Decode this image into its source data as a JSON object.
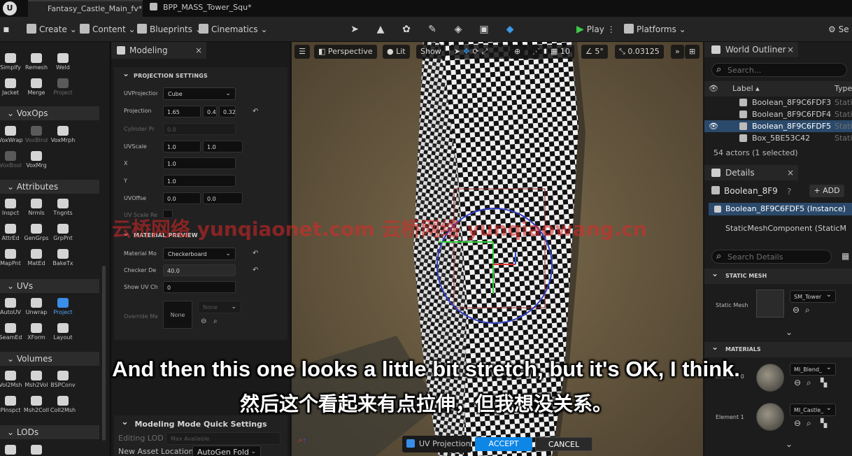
{
  "tabs": [
    {
      "label": "Fantasy_Castle_Main_fv*"
    },
    {
      "label": "BPP_MASS_Tower_Squ*"
    }
  ],
  "toolbar": {
    "create": "Create",
    "content": "Content",
    "blueprints": "Blueprints",
    "cinematics": "Cinematics",
    "play": "Play",
    "platforms": "Platforms",
    "settings": "Se"
  },
  "palette": {
    "top_tools": [
      "Simplfy",
      "Remesh",
      "Weld",
      "Jacket",
      "Merge",
      "Project"
    ],
    "voxops": {
      "title": "VoxOps",
      "tools": [
        "VoxWrap",
        "VoxBlnd",
        "VoxMrph",
        "VoxBool",
        "VoxMrg"
      ]
    },
    "attributes": {
      "title": "Attributes",
      "tools": [
        "Inspct",
        "Nrmls",
        "Tngnts",
        "AttrEd",
        "GenGrps",
        "GrpPnt",
        "MapPnt",
        "MatEd",
        "BakeTx"
      ]
    },
    "uvs": {
      "title": "UVs",
      "tools": [
        "AutoUV",
        "Unwrap",
        "Project",
        "SeamEd",
        "XForm",
        "Layout"
      ]
    },
    "volumes": {
      "title": "Volumes",
      "tools": [
        "Vol2Msh",
        "Msh2Vol",
        "BSPConv",
        "PInspct",
        "Msh2Coll",
        "Coll2Msh"
      ]
    },
    "lods": {
      "title": "LODs"
    }
  },
  "modeling": {
    "tab_title": "Modeling",
    "projection_settings": "PROJECTION SETTINGS",
    "uv_projection_label": "UVProjection",
    "uv_projection_value": "Cube",
    "projection_label": "Projection",
    "projection_values": [
      "1.65",
      "0.41",
      "0.32"
    ],
    "cylinder_label": "Cylinder Pr",
    "cylinder_value": "0.0",
    "uvscale_label": "UVScale",
    "uvscale_values": [
      "1.0",
      "1.0"
    ],
    "x_label": "X",
    "x_value": "1.0",
    "y_label": "Y",
    "y_value": "1.0",
    "uvoffset_label": "UVOffse",
    "uvoffset_values": [
      "0.0",
      "0.0"
    ],
    "uvscale_rel_label": "UV Scale Re",
    "material_preview": "MATERIAL PREVIEW",
    "material_mode_label": "Material Mo",
    "material_mode_value": "Checkerboard",
    "checker_density_label": "Checker De",
    "checker_density_value": "40.0",
    "show_uv_label": "Show UV Ch",
    "show_uv_value": "0",
    "override_label": "Override Ma",
    "override_thumb": "None",
    "override_combo": "None",
    "quick_settings": "Modeling Mode Quick Settings",
    "editing_lod_label": "Editing LOD",
    "editing_lod_value": "Max Available",
    "new_asset_label": "New Asset Location",
    "new_asset_value": "AutoGen Fold"
  },
  "viewport": {
    "perspective": "Perspective",
    "lit": "Lit",
    "show": "Show",
    "grid_value": "10",
    "angle_value": "5°",
    "scale_value": "0.03125",
    "tool_label": "UV Projection",
    "accept": "ACCEPT",
    "cancel": "CANCEL",
    "checker_color": "#f0f0f0",
    "ground_color": "#6b5a3f"
  },
  "outliner": {
    "title": "World Outliner",
    "search_placeholder": "Search...",
    "col_label": "Label",
    "col_type": "Type",
    "rows": [
      {
        "label": "Boolean_8F9C6FDF3",
        "type": "Static"
      },
      {
        "label": "Boolean_8F9C6FDF4",
        "type": "Static"
      },
      {
        "label": "Boolean_8F9C6FDF5",
        "type": "Static"
      },
      {
        "label": "Box_5BE53C42",
        "type": "Static"
      }
    ],
    "status": "54 actors (1 selected)"
  },
  "details": {
    "title": "Details",
    "object_name": "Boolean_8F9",
    "add": "+ ADD",
    "instance": "Boolean_8F9C6FDF5 (Instance)",
    "component": "StaticMeshComponent (StaticM",
    "search_placeholder": "Search Details",
    "static_mesh_section": "STATIC MESH",
    "static_mesh_label": "Static Mesh",
    "static_mesh_value": "SM_Tower",
    "materials_section": "MATERIALS",
    "element0_label": "Element 0",
    "element0_value": "MI_Blend_",
    "element1_label": "Element 1",
    "element1_value": "MI_Castle_"
  },
  "overlay": {
    "watermark": "云桥网络 yunqiaonet.com 云桥网络 yunqiaowang.cn",
    "subtitle_en": "And then this one looks a little bit stretch, but it's OK, I think.",
    "subtitle_zh": "然后这个看起来有点拉伸，但我想没关系。"
  }
}
